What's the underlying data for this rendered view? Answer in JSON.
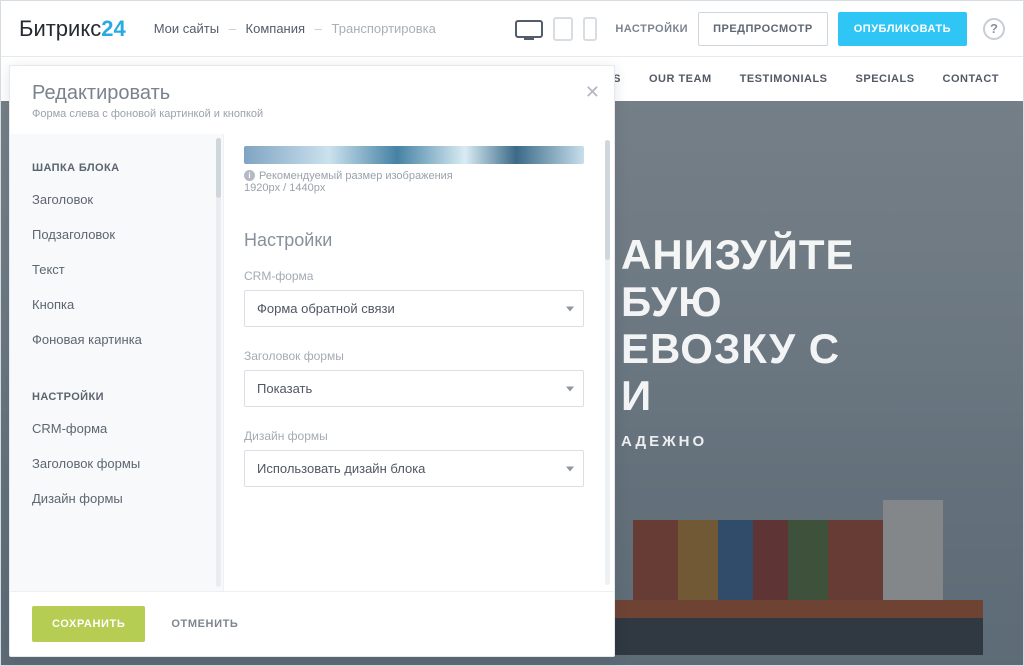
{
  "logo": {
    "part1": "Битрикс",
    "part2": "24"
  },
  "breadcrumbs": {
    "root": "Мои сайты",
    "site": "Компания",
    "page": "Транспортировка"
  },
  "top": {
    "settings": "НАСТРОЙКИ",
    "preview": "ПРЕДПРОСМОТР",
    "publish": "ОПУБЛИКОВАТЬ",
    "help": "?"
  },
  "site_nav": [
    "PRODUCTS",
    "OUR TEAM",
    "TESTIMONIALS",
    "SPECIALS",
    "CONTACT"
  ],
  "hero": {
    "title_lines": [
      "АНИЗУЙТЕ",
      "БУЮ",
      "ЕВОЗКУ С",
      "И"
    ],
    "subtitle": "АДЕЖНО"
  },
  "editor": {
    "title": "Редактировать",
    "subtitle": "Форма слева с фоновой картинкой и кнопкой",
    "close": "✕",
    "sidebar": {
      "group1": "ШАПКА БЛОКА",
      "items1": [
        "Заголовок",
        "Подзаголовок",
        "Текст",
        "Кнопка",
        "Фоновая картинка"
      ],
      "group2": "НАСТРОЙКИ",
      "items2": [
        "CRM-форма",
        "Заголовок формы",
        "Дизайн формы"
      ]
    },
    "hint_label": "Рекомендуемый размер изображения",
    "hint_size": "1920px / 1440px",
    "section_heading": "Настройки",
    "fields": {
      "crm_form": {
        "label": "CRM-форма",
        "value": "Форма обратной связи"
      },
      "form_title": {
        "label": "Заголовок формы",
        "value": "Показать"
      },
      "form_design": {
        "label": "Дизайн формы",
        "value": "Использовать дизайн блока"
      }
    },
    "save": "СОХРАНИТЬ",
    "cancel": "ОТМЕНИТЬ"
  }
}
